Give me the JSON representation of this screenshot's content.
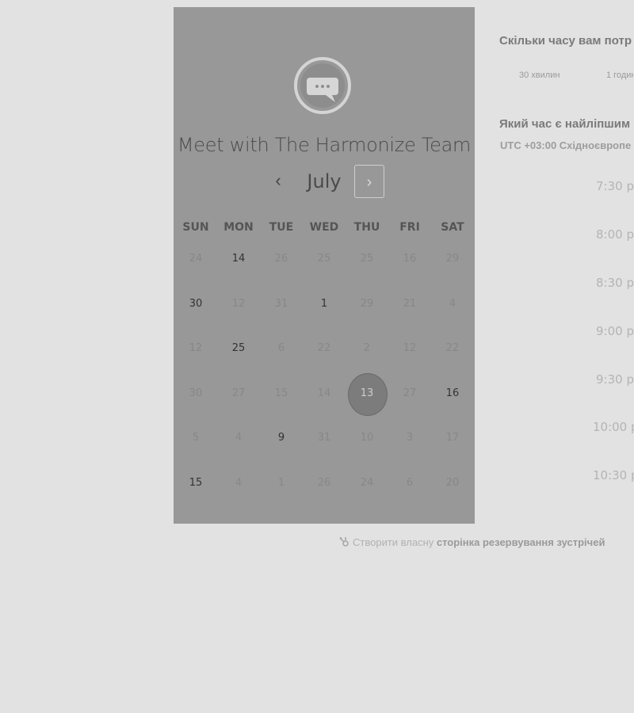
{
  "card": {
    "team_title": "Meet with The Harmonize Team",
    "month": "July",
    "avatar_icon": "chat-bubble-icon"
  },
  "weekdays": [
    "SUN",
    "MON",
    "TUE",
    "WED",
    "THU",
    "FRI",
    "SAT"
  ],
  "calendar": {
    "weeks": [
      [
        {
          "d": "24",
          "on": false
        },
        {
          "d": "14",
          "on": true
        },
        {
          "d": "26",
          "on": false
        },
        {
          "d": "25",
          "on": false
        },
        {
          "d": "25",
          "on": false
        },
        {
          "d": "16",
          "on": false
        },
        {
          "d": "29",
          "on": false
        }
      ],
      [
        {
          "d": "30",
          "on": true
        },
        {
          "d": "12",
          "on": false
        },
        {
          "d": "31",
          "on": false
        },
        {
          "d": "1",
          "on": true
        },
        {
          "d": "29",
          "on": false
        },
        {
          "d": "21",
          "on": false
        },
        {
          "d": "4",
          "on": false
        }
      ],
      [
        {
          "d": "12",
          "on": false
        },
        {
          "d": "25",
          "on": true
        },
        {
          "d": "6",
          "on": false
        },
        {
          "d": "22",
          "on": false
        },
        {
          "d": "2",
          "on": false
        },
        {
          "d": "12",
          "on": false
        },
        {
          "d": "22",
          "on": false
        }
      ],
      [
        {
          "d": "30",
          "on": false
        },
        {
          "d": "27",
          "on": false
        },
        {
          "d": "15",
          "on": false
        },
        {
          "d": "14",
          "on": false
        },
        {
          "d": "13",
          "on": false,
          "selected": true
        },
        {
          "d": "27",
          "on": false
        },
        {
          "d": "16",
          "on": true
        }
      ],
      [
        {
          "d": "5",
          "on": false
        },
        {
          "d": "4",
          "on": false
        },
        {
          "d": "9",
          "on": true
        },
        {
          "d": "31",
          "on": false
        },
        {
          "d": "10",
          "on": false
        },
        {
          "d": "3",
          "on": false
        },
        {
          "d": "17",
          "on": false
        }
      ],
      [
        {
          "d": "15",
          "on": true
        },
        {
          "d": "4",
          "on": false
        },
        {
          "d": "1",
          "on": false
        },
        {
          "d": "26",
          "on": false
        },
        {
          "d": "24",
          "on": false
        },
        {
          "d": "6",
          "on": false
        },
        {
          "d": "20",
          "on": false
        }
      ]
    ]
  },
  "duration": {
    "question": "Скільки часу вам потр",
    "options": [
      "30 хвилин",
      "1 годин"
    ]
  },
  "time": {
    "question": "Який час є найліпшим",
    "timezone": "UTC +03:00 Східноєвропе",
    "slots": [
      "7:30 p",
      "8:00 p",
      "8:30 p",
      "9:00 p",
      "9:30 p",
      "10:00 p",
      "10:30 p"
    ]
  },
  "footer": {
    "prefix": "Створити власну ",
    "link": "сторінка резервування зустрічей",
    "icon": "hubspot-sprocket-icon"
  }
}
